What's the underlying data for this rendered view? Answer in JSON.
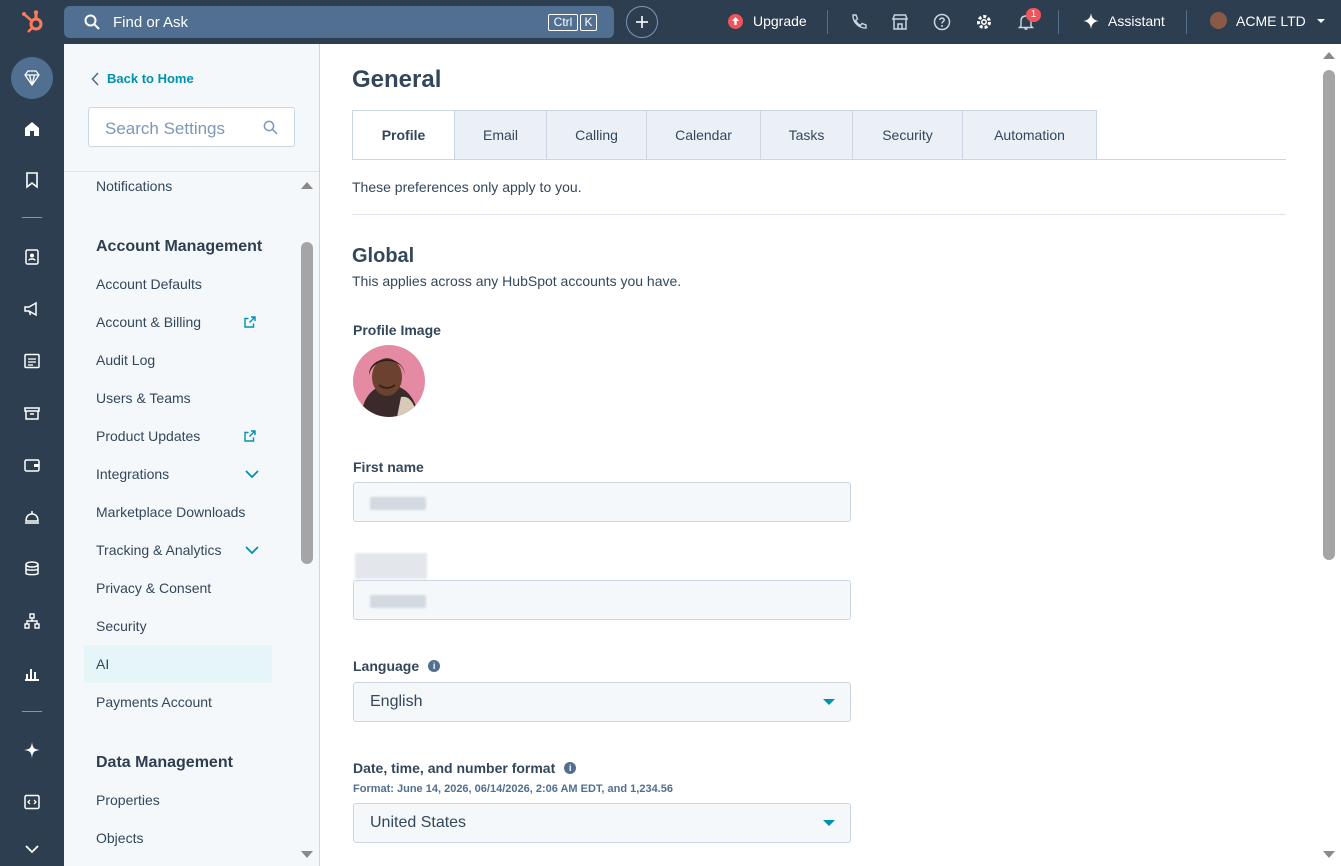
{
  "topbar": {
    "search_placeholder": "Find or Ask",
    "kbd_ctrl": "Ctrl",
    "kbd_k": "K",
    "upgrade_label": "Upgrade",
    "notification_count": "1",
    "assistant_label": "Assistant",
    "account_name": "ACME LTD"
  },
  "sidebar": {
    "back_label": "Back to Home",
    "search_placeholder": "Search Settings",
    "items": [
      {
        "label": "Notifications"
      },
      {
        "label": "Account Management",
        "heading": true
      },
      {
        "label": "Account Defaults"
      },
      {
        "label": "Account & Billing",
        "external": true
      },
      {
        "label": "Audit Log"
      },
      {
        "label": "Users & Teams"
      },
      {
        "label": "Product Updates",
        "external": true
      },
      {
        "label": "Integrations",
        "expandable": true
      },
      {
        "label": "Marketplace Downloads"
      },
      {
        "label": "Tracking & Analytics",
        "expandable": true
      },
      {
        "label": "Privacy & Consent"
      },
      {
        "label": "Security"
      },
      {
        "label": "AI",
        "active": true
      },
      {
        "label": "Payments Account"
      },
      {
        "label": "Data Management",
        "heading": true
      },
      {
        "label": "Properties"
      },
      {
        "label": "Objects"
      }
    ]
  },
  "main": {
    "title": "General",
    "tabs": [
      {
        "label": "Profile",
        "active": true
      },
      {
        "label": "Email"
      },
      {
        "label": "Calling"
      },
      {
        "label": "Calendar"
      },
      {
        "label": "Tasks"
      },
      {
        "label": "Security"
      },
      {
        "label": "Automation"
      }
    ],
    "note": "These preferences only apply to you.",
    "global_heading": "Global",
    "global_sub": "This applies across any HubSpot accounts you have.",
    "profile_image_label": "Profile Image",
    "first_name_label": "First name",
    "language_label": "Language",
    "language_value": "English",
    "date_format_label": "Date, time, and number format",
    "date_format_example": "Format: June 14, 2026, 06/14/2026, 2:06 AM EDT, and 1,234.56",
    "date_format_value": "United States"
  },
  "colors": {
    "topbar": "#2d3e50",
    "accent": "#0091ae",
    "badge": "#f2545b"
  }
}
